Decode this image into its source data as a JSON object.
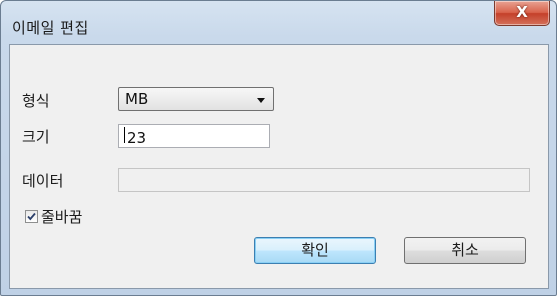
{
  "window": {
    "title": "이메일 편집",
    "close_label": "X"
  },
  "form": {
    "format_label": "형식",
    "format_value": "MB",
    "size_label": "크기",
    "size_value": "23",
    "data_label": "데이터",
    "data_value": "",
    "wrap_label": "줄바꿈",
    "wrap_checked": true
  },
  "buttons": {
    "ok_label": "확인",
    "cancel_label": "취소"
  }
}
